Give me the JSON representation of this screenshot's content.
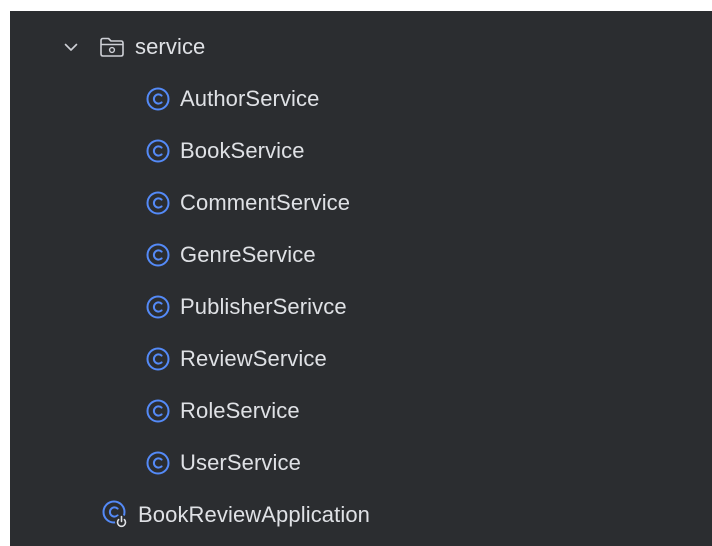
{
  "tree": {
    "folder": {
      "label": "service",
      "expanded": true,
      "icon": "folder-icon"
    },
    "classes": [
      {
        "label": "AuthorService",
        "icon": "class-icon"
      },
      {
        "label": "BookService",
        "icon": "class-icon"
      },
      {
        "label": "CommentService",
        "icon": "class-icon"
      },
      {
        "label": "GenreService",
        "icon": "class-icon"
      },
      {
        "label": "PublisherSerivce",
        "icon": "class-icon"
      },
      {
        "label": "ReviewService",
        "icon": "class-icon"
      },
      {
        "label": "RoleService",
        "icon": "class-icon"
      },
      {
        "label": "UserService",
        "icon": "class-icon"
      }
    ],
    "application": {
      "label": "BookReviewApplication",
      "icon": "spring-boot-application-icon"
    }
  },
  "colors": {
    "background": "#2b2d30",
    "text": "#dfe1e5",
    "class_icon": "#548af7",
    "chevron": "#ced0d6"
  }
}
